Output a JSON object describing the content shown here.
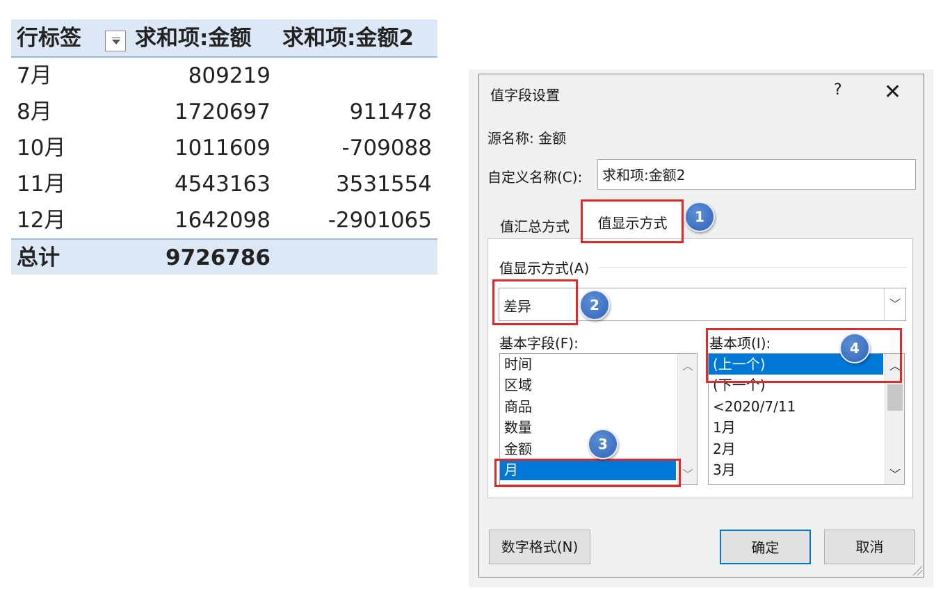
{
  "pivot": {
    "headers": {
      "row_label": "行标签",
      "sum1": "求和项:金额",
      "sum2": "求和项:金额2"
    },
    "rows": [
      {
        "label": "7月",
        "v1": "809219",
        "v2": ""
      },
      {
        "label": "8月",
        "v1": "1720697",
        "v2": "911478"
      },
      {
        "label": "10月",
        "v1": "1011609",
        "v2": "-709088"
      },
      {
        "label": "11月",
        "v1": "4543163",
        "v2": "3531554"
      },
      {
        "label": "12月",
        "v1": "1642098",
        "v2": "-2901065"
      }
    ],
    "total": {
      "label": "总计",
      "v1": "9726786",
      "v2": ""
    }
  },
  "dialog": {
    "title": "值字段设置",
    "help": "?",
    "close": "✕",
    "source_name": "源名称:  金额",
    "custom_name_label": "自定义名称(C):",
    "custom_name_value": "求和项:金额2",
    "tabs": {
      "summarize": "值汇总方式",
      "show_as": "值显示方式"
    },
    "show_as_label": "值显示方式(A)",
    "show_as_value": "差异",
    "base_field_label": "基本字段(F):",
    "base_item_label": "基本项(I):",
    "base_fields": [
      "时间",
      "区域",
      "商品",
      "数量",
      "金额",
      "月"
    ],
    "base_field_selected": "月",
    "base_items": [
      "(上一个)",
      "(下一个)",
      "<2020/7/11",
      "1月",
      "2月",
      "3月"
    ],
    "base_item_selected": "(上一个)",
    "buttons": {
      "number_format": "数字格式(N)",
      "ok": "确定",
      "cancel": "取消"
    }
  },
  "annotations": {
    "badge1": "1",
    "badge2": "2",
    "badge3": "3",
    "badge4": "4"
  },
  "colors": {
    "selection": "#0078d7",
    "highlight": "#e02a2a",
    "badge": "#3a6fc4",
    "pivot_header": "#dce8f6"
  }
}
